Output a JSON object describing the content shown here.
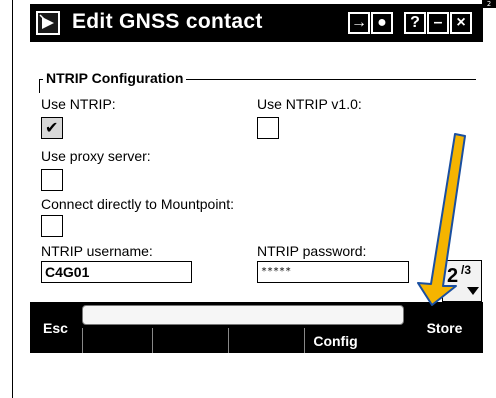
{
  "window": {
    "title": "Edit GNSS contact",
    "corner_tag": "2"
  },
  "titlebar_buttons": {
    "switch_label": "→",
    "keyboard_label": "●",
    "help_label": "?",
    "minimize_label": "–",
    "close_label": "×"
  },
  "group": {
    "title": "NTRIP Configuration"
  },
  "fields": {
    "use_ntrip": {
      "label": "Use NTRIP:",
      "checked": true,
      "check_glyph": "✔"
    },
    "use_ntrip_v1": {
      "label": "Use NTRIP v1.0:",
      "checked": false
    },
    "use_proxy": {
      "label": "Use proxy server:",
      "checked": false
    },
    "connect_direct": {
      "label": "Connect directly to Mountpoint:",
      "checked": false
    },
    "username": {
      "label": "NTRIP username:",
      "value": "C4G01"
    },
    "password": {
      "label": "NTRIP password:",
      "value": "*****"
    }
  },
  "page_indicator": {
    "current": "2",
    "fraction": "/3"
  },
  "softkeys": {
    "esc_label": "Esc",
    "store_label": "Store",
    "config_label": "Config"
  },
  "annotation": {
    "color": "#f5b400",
    "outline": "#1a4fa0"
  }
}
